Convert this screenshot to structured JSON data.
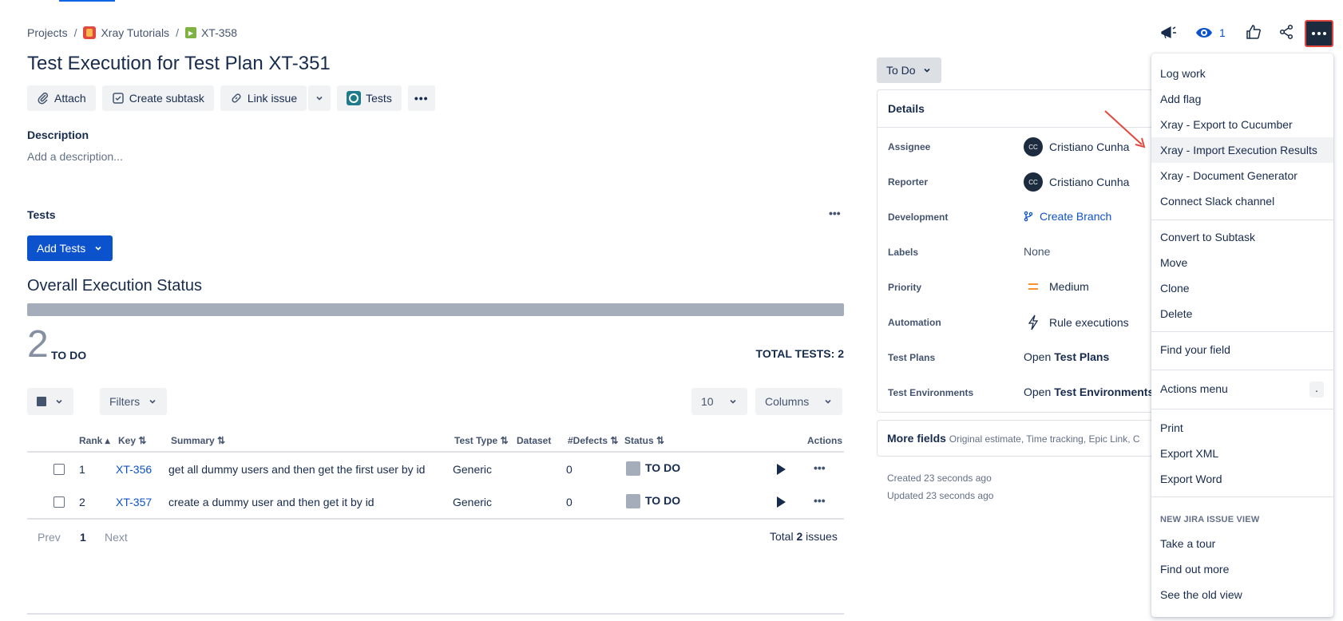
{
  "breadcrumb": {
    "projects": "Projects",
    "sep": "/",
    "project": "Xray Tutorials",
    "issue_key": "XT-358"
  },
  "issue": {
    "title": "Test Execution for Test Plan XT-351",
    "watchers": "1"
  },
  "toolbar": {
    "attach": "Attach",
    "create_subtask": "Create subtask",
    "link_issue": "Link issue",
    "tests": "Tests"
  },
  "description": {
    "label": "Description",
    "placeholder": "Add a description..."
  },
  "tests_section": {
    "label": "Tests",
    "add_tests": "Add Tests",
    "overall_title": "Overall Execution Status",
    "count": "2",
    "count_status": "TO DO",
    "total": "TOTAL TESTS: 2",
    "filters": "Filters",
    "page_size": "10",
    "columns": "Columns"
  },
  "table": {
    "headers": {
      "rank": "Rank",
      "key": "Key",
      "summary": "Summary",
      "test_type": "Test Type",
      "dataset": "Dataset",
      "defects": "#Defects",
      "status": "Status",
      "actions": "Actions"
    },
    "rows": [
      {
        "rank": "1",
        "key": "XT-356",
        "summary": "get all dummy users and then get the first user by id",
        "type": "Generic",
        "defects": "0",
        "status": "TO DO"
      },
      {
        "rank": "2",
        "key": "XT-357",
        "summary": "create a dummy user and then get it by id",
        "type": "Generic",
        "defects": "0",
        "status": "TO DO"
      }
    ],
    "pagination": {
      "prev": "Prev",
      "page": "1",
      "next": "Next",
      "total_prefix": "Total",
      "total_count": "2",
      "total_suffix": "issues"
    }
  },
  "details": {
    "status_button": "To Do",
    "heading": "Details",
    "assignee_label": "Assignee",
    "assignee": "Cristiano Cunha",
    "reporter_label": "Reporter",
    "reporter": "Cristiano Cunha",
    "avatar_initials": "CC",
    "development_label": "Development",
    "development": "Create Branch",
    "labels_label": "Labels",
    "labels": "None",
    "priority_label": "Priority",
    "priority": "Medium",
    "automation_label": "Automation",
    "automation": "Rule executions",
    "test_plans_label": "Test Plans",
    "test_plans_prefix": "Open",
    "test_plans": "Test Plans",
    "test_env_label": "Test Environments",
    "test_env_prefix": "Open",
    "test_env": "Test Environments",
    "more_fields": "More fields",
    "more_fields_hint": "Original estimate, Time tracking, Epic Link, C",
    "created": "Created 23 seconds ago",
    "updated": "Updated 23 seconds ago"
  },
  "menu": {
    "items": [
      "Log work",
      "Add flag",
      "Xray - Export to Cucumber",
      "Xray - Import Execution Results",
      "Xray - Document Generator",
      "Connect Slack channel",
      "Convert to Subtask",
      "Move",
      "Clone",
      "Delete",
      "Find your field",
      "Actions menu",
      "Print",
      "Export XML",
      "Export Word",
      "Take a tour",
      "Find out more",
      "See the old view"
    ],
    "actions_shortcut": ".",
    "section_heading": "NEW JIRA ISSUE VIEW",
    "highlighted": "Xray - Import Execution Results"
  },
  "colors": {
    "primary": "#0c52cc",
    "annotation_red": "#e2483d",
    "progress_todo": "#a5adba"
  }
}
